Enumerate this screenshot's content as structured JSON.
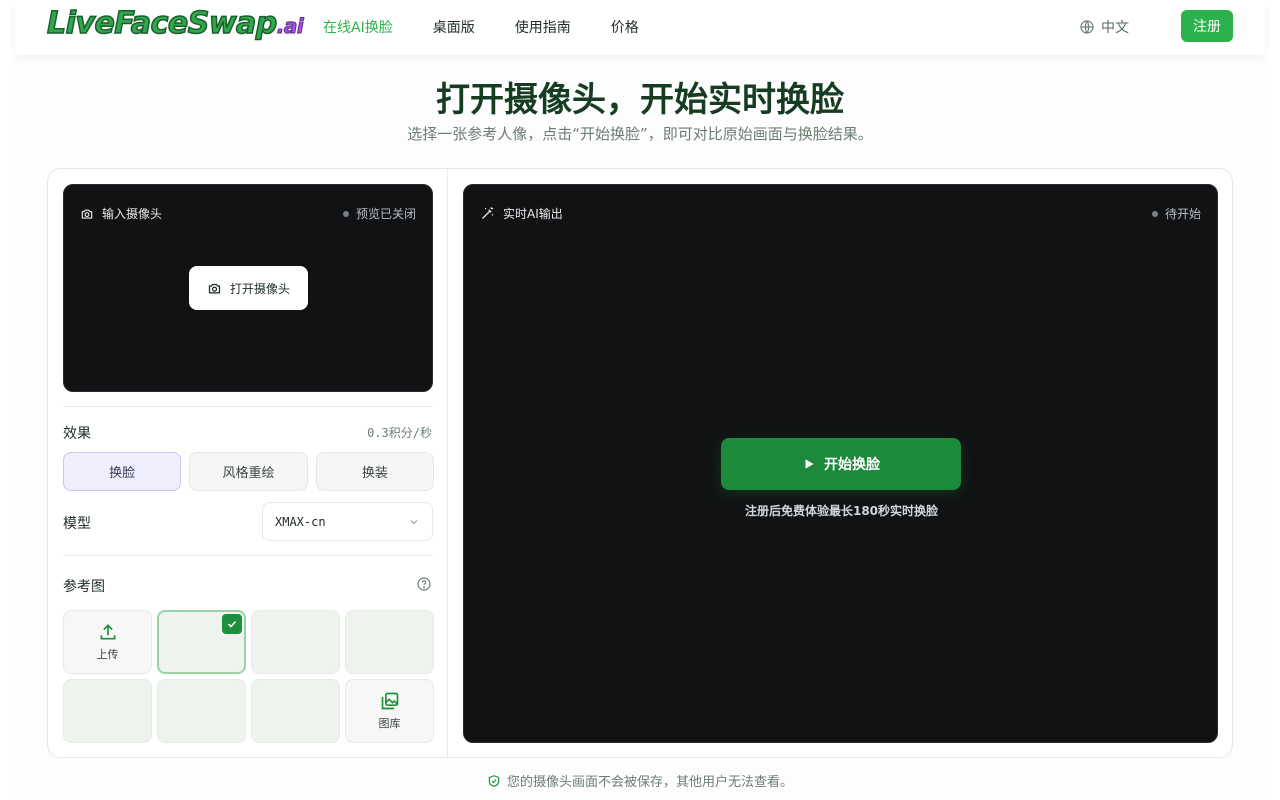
{
  "brand": {
    "logo_main": "LiveFaceSwap",
    "logo_suffix": ".ai"
  },
  "nav": {
    "items": [
      {
        "label": "在线AI换脸",
        "active": true
      },
      {
        "label": "桌面版",
        "active": false
      },
      {
        "label": "使用指南",
        "active": false
      },
      {
        "label": "价格",
        "active": false
      }
    ],
    "language": "中文",
    "signup": "注册"
  },
  "hero": {
    "title": "打开摄像头，开始实时换脸",
    "subtitle": "选择一张参考人像，点击“开始换脸”，即可对比原始画面与换脸结果。"
  },
  "input_panel": {
    "label": "输入摄像头",
    "status": "预览已关闭",
    "open_button": "打开摄像头"
  },
  "effect": {
    "label": "效果",
    "credits": "0.3积分/秒",
    "options": [
      "换脸",
      "风格重绘",
      "换装"
    ],
    "selected": "换脸"
  },
  "model": {
    "label": "模型",
    "value": "XMAX-cn"
  },
  "reference": {
    "label": "参考图",
    "upload_label": "上传",
    "gallery_label": "图库"
  },
  "output_panel": {
    "label": "实时AI输出",
    "status": "待开始",
    "start_button": "开始换脸",
    "hint": "注册后免费体验最长180秒实时换脸"
  },
  "footer": {
    "privacy": "您的摄像头画面不会被保存，其他用户无法查看。"
  },
  "colors": {
    "accent": "#2bb24c",
    "dark": "#111214",
    "primary_button": "#1c8a3a"
  }
}
